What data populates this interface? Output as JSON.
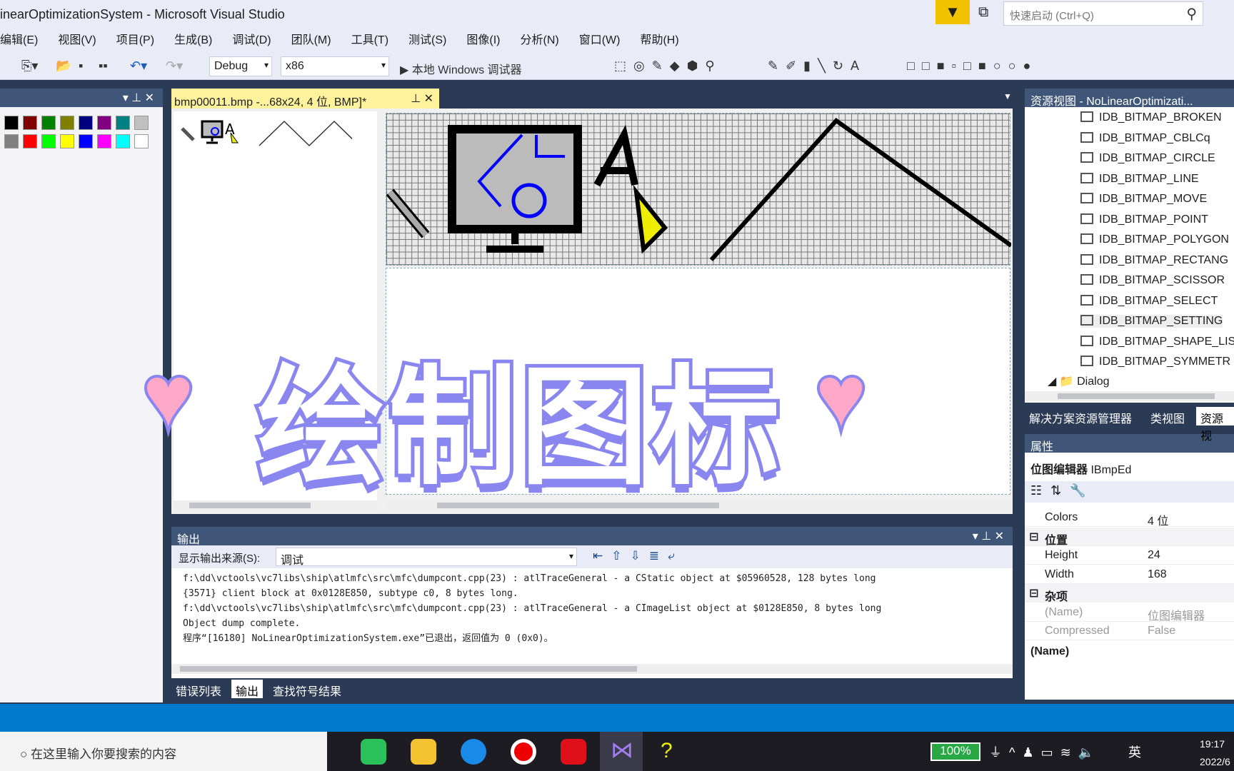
{
  "window": {
    "title": "inearOptimizationSystem - Microsoft Visual Studio",
    "quick_launch_placeholder": "快速启动 (Ctrl+Q)"
  },
  "menu": [
    "编辑(E)",
    "视图(V)",
    "项目(P)",
    "生成(B)",
    "调试(D)",
    "团队(M)",
    "工具(T)",
    "测试(S)",
    "图像(I)",
    "分析(N)",
    "窗口(W)",
    "帮助(H)"
  ],
  "toolbar": {
    "config": "Debug",
    "platform": "x86",
    "run": "▶ 本地 Windows 调试器"
  },
  "palette": {
    "colors_row1": [
      "#000000",
      "#800000",
      "#008000",
      "#808000",
      "#000080",
      "#800080",
      "#008080",
      "#c0c0c0"
    ],
    "colors_row2": [
      "#808080",
      "#ff0000",
      "#00ff00",
      "#ffff00",
      "#0000ff",
      "#ff00ff",
      "#00ffff",
      "#ffffff"
    ]
  },
  "doc_tab": {
    "label": "bmp00011.bmp -...68x24, 4 位, BMP]*"
  },
  "output": {
    "title": "输出",
    "source_label": "显示输出来源(S):",
    "source_value": "调试",
    "lines": [
      "f:\\dd\\vctools\\vc7libs\\ship\\atlmfc\\src\\mfc\\dumpcont.cpp(23) : atlTraceGeneral - a CStatic object at $05960528, 128 bytes long",
      "{3571} client block at 0x0128E850, subtype c0, 8 bytes long.",
      "f:\\dd\\vctools\\vc7libs\\ship\\atlmfc\\src\\mfc\\dumpcont.cpp(23) : atlTraceGeneral - a CImageList object at $0128E850, 8 bytes long",
      "Object dump complete.",
      "程序“[16180] NoLinearOptimizationSystem.exe”已退出，返回值为 0 (0x0)。"
    ]
  },
  "bottom_tabs": [
    "错误列表",
    "输出",
    "查找符号结果"
  ],
  "resource_view": {
    "title": "资源视图 - NoLinearOptimizati...",
    "items": [
      "IDB_BITMAP_BROKEN",
      "IDB_BITMAP_CBLCq",
      "IDB_BITMAP_CIRCLE",
      "IDB_BITMAP_LINE",
      "IDB_BITMAP_MOVE",
      "IDB_BITMAP_POINT",
      "IDB_BITMAP_POLYGON",
      "IDB_BITMAP_RECTANG",
      "IDB_BITMAP_SCISSOR",
      "IDB_BITMAP_SELECT",
      "IDB_BITMAP_SETTING",
      "IDB_BITMAP_SHAPE_LIS",
      "IDB_BITMAP_SYMMETR"
    ],
    "folder": "Dialog",
    "selected": "IDB_BITMAP_SETTING"
  },
  "side_tabs": [
    "解决方案资源管理器",
    "类视图",
    "资源视"
  ],
  "properties": {
    "title": "属性",
    "object": "位图编辑器",
    "object_type": "IBmpEd",
    "rows": [
      {
        "k": "Colors",
        "v": "4 位"
      },
      {
        "k": "位置",
        "v": "",
        "cat": true
      },
      {
        "k": "Height",
        "v": "24"
      },
      {
        "k": "Width",
        "v": "168"
      },
      {
        "k": "杂项",
        "v": "",
        "cat": true
      },
      {
        "k": "(Name)",
        "v": "位图编辑器"
      },
      {
        "k": "Compressed",
        "v": "False"
      }
    ],
    "desc_title": "(Name)"
  },
  "taskbar": {
    "search_placeholder": "在这里输入你要搜索的内容",
    "battery": "100%",
    "ime": "英",
    "time": "19:17",
    "date": "2022/6"
  },
  "overlay": {
    "caption": "绘制图标"
  }
}
